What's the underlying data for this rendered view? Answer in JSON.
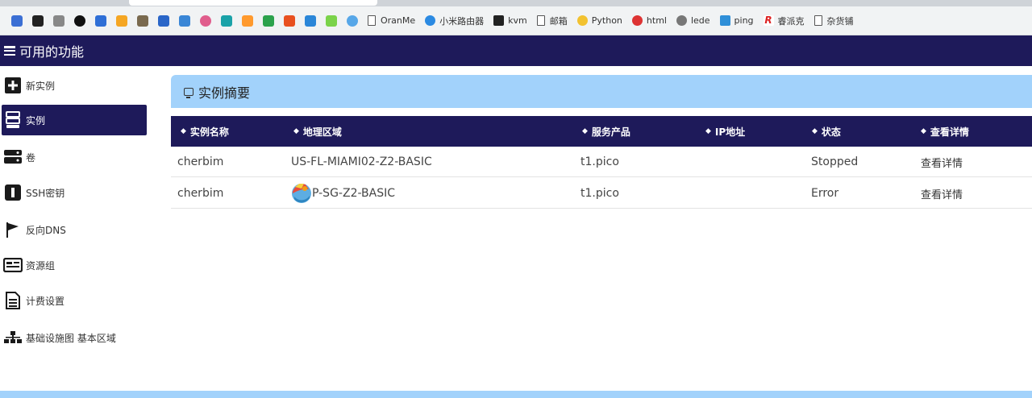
{
  "browser": {
    "bookmarks": [
      {
        "label": "OranMe",
        "icon": "document-icon"
      },
      {
        "label": "小米路由器",
        "icon": "wifi-icon"
      },
      {
        "label": "kvm",
        "icon": "bt-icon"
      },
      {
        "label": "邮箱",
        "icon": "document-icon"
      },
      {
        "label": "Python",
        "icon": "python-icon"
      },
      {
        "label": "html",
        "icon": "html-icon"
      },
      {
        "label": "lede",
        "icon": "antenna-icon"
      },
      {
        "label": "ping",
        "icon": "ping-icon"
      },
      {
        "label": "睿派克",
        "icon": "r-icon"
      },
      {
        "label": "杂货铺",
        "icon": "document-icon"
      }
    ]
  },
  "header": {
    "title": "可用的功能"
  },
  "sidebar": {
    "items": [
      {
        "label": "新实例",
        "icon": "plus-icon"
      },
      {
        "label": "实例",
        "icon": "server-icon",
        "active": true
      },
      {
        "label": "卷",
        "icon": "drive-icon"
      },
      {
        "label": "SSH密钥",
        "icon": "key-icon"
      },
      {
        "label": "反向DNS",
        "icon": "flag-icon"
      },
      {
        "label": "资源组",
        "icon": "id-card-icon"
      },
      {
        "label": "计费设置",
        "icon": "file-icon"
      },
      {
        "label": "基础设施图 基本区域",
        "icon": "sitemap-icon"
      }
    ]
  },
  "main": {
    "panel_title": "实例摘要",
    "columns": [
      "实例名称",
      "地理区域",
      "服务产品",
      "IP地址",
      "状态",
      "查看详情"
    ],
    "rows": [
      {
        "name": "cherbim",
        "region": "US-FL-MIAMI02-Z2-BASIC",
        "product": "t1.pico",
        "ip": "",
        "status": "Stopped",
        "detail": "查看详情"
      },
      {
        "name": "cherbim",
        "region": "P-SG-Z2-BASIC",
        "product": "t1.pico",
        "ip": "",
        "status": "Error",
        "detail": "查看详情"
      }
    ]
  },
  "colors": {
    "nav": "#1e1a5a",
    "panel_header": "#a2d2fb",
    "text": "#444444"
  }
}
